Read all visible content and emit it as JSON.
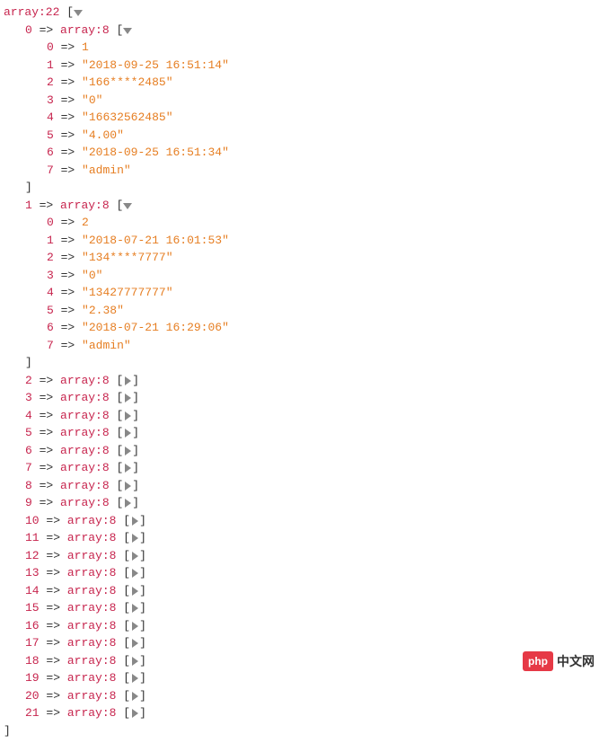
{
  "root": {
    "label": "array:22",
    "open": "[",
    "close": "]"
  },
  "expanded": [
    {
      "index": 0,
      "label": "array:8",
      "items": [
        {
          "k": "0",
          "v": "1",
          "isStr": false
        },
        {
          "k": "1",
          "v": "2018-09-25 16:51:14",
          "isStr": true
        },
        {
          "k": "2",
          "v": "166****2485",
          "isStr": true
        },
        {
          "k": "3",
          "v": "0",
          "isStr": true
        },
        {
          "k": "4",
          "v": "16632562485",
          "isStr": true
        },
        {
          "k": "5",
          "v": "4.00",
          "isStr": true
        },
        {
          "k": "6",
          "v": "2018-09-25 16:51:34",
          "isStr": true
        },
        {
          "k": "7",
          "v": "admin",
          "isStr": true
        }
      ]
    },
    {
      "index": 1,
      "label": "array:8",
      "items": [
        {
          "k": "0",
          "v": "2",
          "isStr": false
        },
        {
          "k": "1",
          "v": "2018-07-21 16:01:53",
          "isStr": true
        },
        {
          "k": "2",
          "v": "134****7777",
          "isStr": true
        },
        {
          "k": "3",
          "v": "0",
          "isStr": true
        },
        {
          "k": "4",
          "v": "13427777777",
          "isStr": true
        },
        {
          "k": "5",
          "v": "2.38",
          "isStr": true
        },
        {
          "k": "6",
          "v": "2018-07-21 16:29:06",
          "isStr": true
        },
        {
          "k": "7",
          "v": "admin",
          "isStr": true
        }
      ]
    }
  ],
  "collapsed": [
    {
      "index": 2,
      "label": "array:8"
    },
    {
      "index": 3,
      "label": "array:8"
    },
    {
      "index": 4,
      "label": "array:8"
    },
    {
      "index": 5,
      "label": "array:8"
    },
    {
      "index": 6,
      "label": "array:8"
    },
    {
      "index": 7,
      "label": "array:8"
    },
    {
      "index": 8,
      "label": "array:8"
    },
    {
      "index": 9,
      "label": "array:8"
    },
    {
      "index": 10,
      "label": "array:8"
    },
    {
      "index": 11,
      "label": "array:8"
    },
    {
      "index": 12,
      "label": "array:8"
    },
    {
      "index": 13,
      "label": "array:8"
    },
    {
      "index": 14,
      "label": "array:8"
    },
    {
      "index": 15,
      "label": "array:8"
    },
    {
      "index": 16,
      "label": "array:8"
    },
    {
      "index": 17,
      "label": "array:8"
    },
    {
      "index": 18,
      "label": "array:8"
    },
    {
      "index": 19,
      "label": "array:8"
    },
    {
      "index": 20,
      "label": "array:8"
    },
    {
      "index": 21,
      "label": "array:8"
    }
  ],
  "watermark": {
    "icon": "php",
    "text": "中文网"
  }
}
